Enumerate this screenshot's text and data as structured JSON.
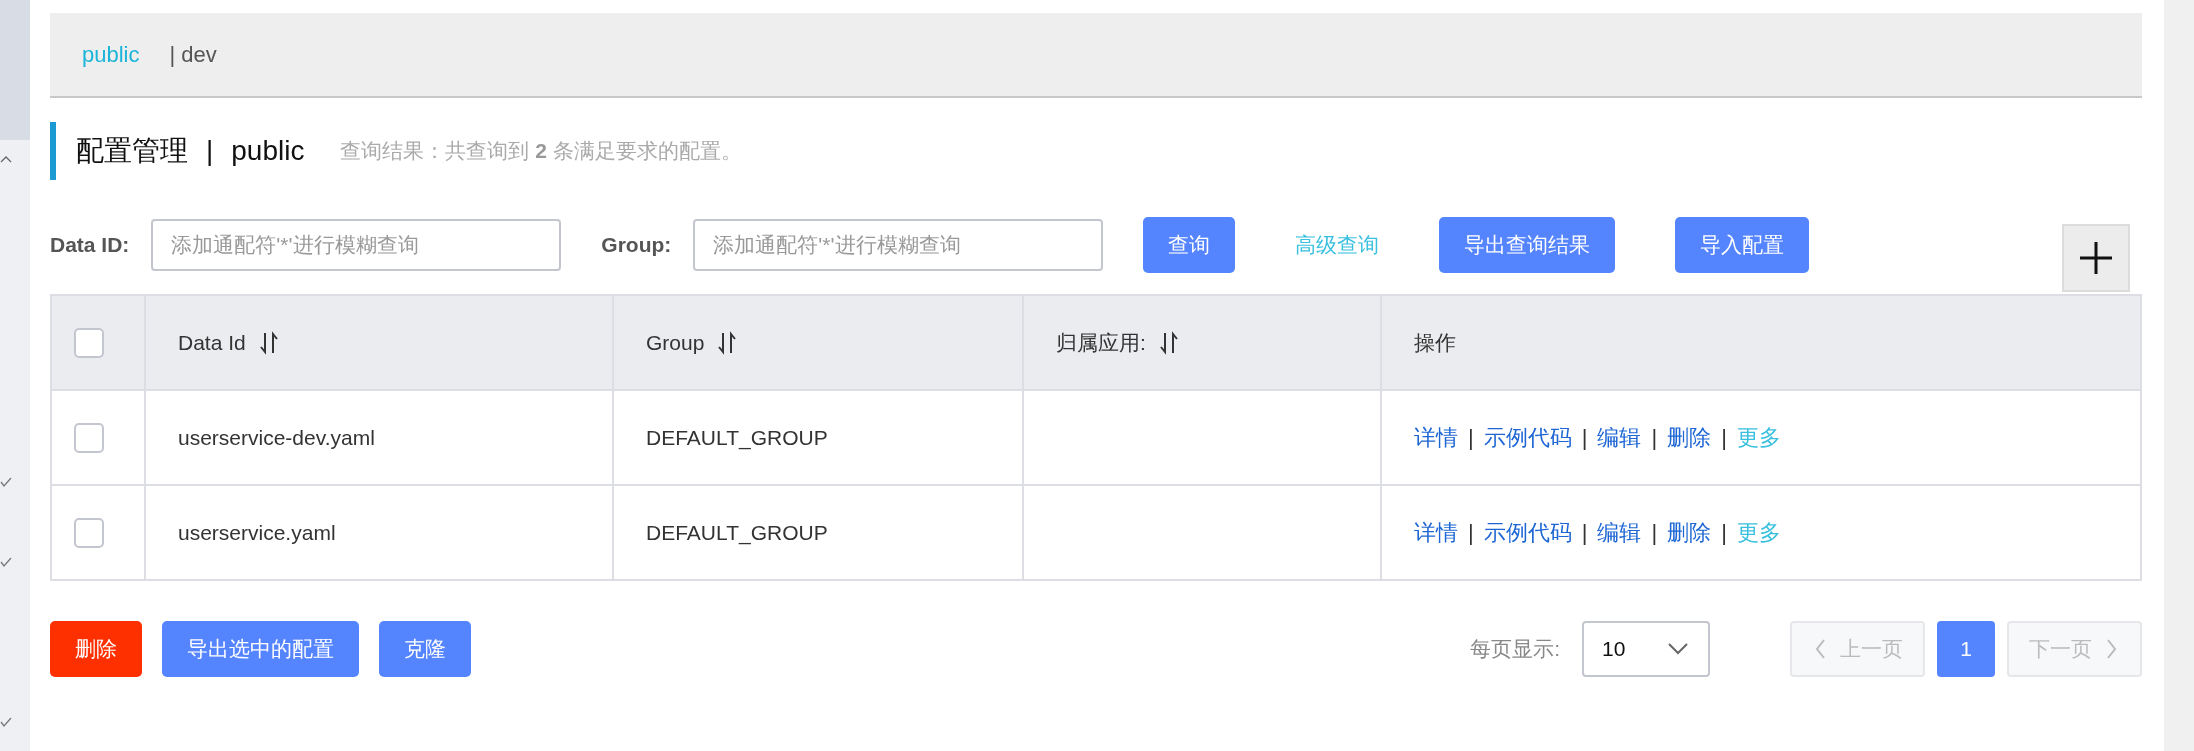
{
  "namespaces": [
    {
      "label": "public",
      "selected": true
    },
    {
      "label": "| dev",
      "selected": false
    }
  ],
  "title": {
    "heading": "配置管理",
    "separator": "|",
    "namespace": "public",
    "result": "查询结果：共查询到 **2** 条满足要求的配置。"
  },
  "filters": [
    {
      "label": "Data ID:",
      "placeholder": "添加通配符'*'进行模糊查询"
    },
    {
      "label": "Group:",
      "placeholder": "添加通配符'*'进行模糊查询"
    }
  ],
  "toolbar": [
    {
      "label": "查询",
      "kind": "primary"
    },
    {
      "label": "高级查询",
      "kind": "link"
    },
    {
      "label": "导出查询结果",
      "kind": "primary"
    },
    {
      "label": "导入配置",
      "kind": "primary"
    }
  ],
  "table": {
    "header_checked": false,
    "columns": [
      {
        "label": "Data Id",
        "sortable": true
      },
      {
        "label": "Group",
        "sortable": true
      },
      {
        "label": "归属应用:",
        "sortable": true
      },
      {
        "label": "操作",
        "sortable": false
      }
    ],
    "rows": [
      {
        "checked": false,
        "data_id": "userservice-dev.yaml",
        "group": "DEFAULT_GROUP",
        "actions": [
          {
            "label": "详情",
            "kind": "link"
          },
          {
            "label": "|",
            "kind": "separator"
          },
          {
            "label": "示例代码",
            "kind": "link"
          },
          {
            "label": "|",
            "kind": "separator"
          },
          {
            "label": "编辑",
            "kind": "link"
          },
          {
            "label": "|",
            "kind": "separator"
          },
          {
            "label": "删除",
            "kind": "link"
          },
          {
            "label": "|",
            "kind": "separator"
          },
          {
            "label": "更多",
            "kind": "more"
          }
        ]
      },
      {
        "checked": false,
        "data_id": "userservice.yaml",
        "group": "DEFAULT_GROUP",
        "actions": [
          {
            "label": "详情",
            "kind": "link"
          },
          {
            "label": "|",
            "kind": "separator"
          },
          {
            "label": "示例代码",
            "kind": "link"
          },
          {
            "label": "|",
            "kind": "separator"
          },
          {
            "label": "编辑",
            "kind": "link"
          },
          {
            "label": "|",
            "kind": "separator"
          },
          {
            "label": "删除",
            "kind": "link"
          },
          {
            "label": "|",
            "kind": "separator"
          },
          {
            "label": "更多",
            "kind": "more"
          }
        ]
      }
    ]
  },
  "bulk_actions": [
    {
      "label": "删除",
      "kind": "danger"
    },
    {
      "label": "导出选中的配置",
      "kind": "primary"
    },
    {
      "label": "克隆",
      "kind": "primary"
    }
  ],
  "pagination": {
    "page_size_label": "每页显示:",
    "page_size": "10",
    "prev": "上一页",
    "next": "下一页",
    "pages": [
      {
        "label": "1",
        "selected": true
      }
    ]
  }
}
